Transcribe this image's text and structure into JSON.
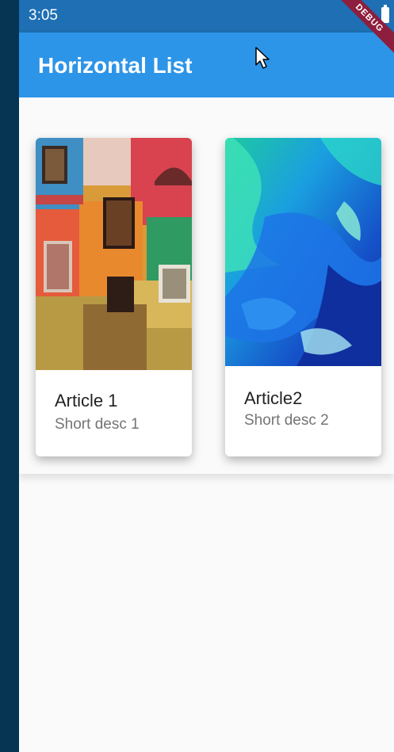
{
  "status_bar": {
    "time": "3:05"
  },
  "app_bar": {
    "title": "Horizontal List"
  },
  "debug_banner": {
    "label": "DEBUG"
  },
  "articles": [
    {
      "title": "Article 1",
      "description": "Short desc 1",
      "image": "colorful-painted-wall-with-windows"
    },
    {
      "title": "Article2",
      "description": "Short desc 2",
      "image": "blue-abstract-fluid-art"
    }
  ],
  "icons": {
    "battery": "battery-icon",
    "cursor": "mouse-pointer-icon"
  },
  "colors": {
    "status_bar": "#1e6fb3",
    "app_bar": "#2d95e8",
    "debug": "#8e1e3d",
    "background": "#fafafa"
  }
}
